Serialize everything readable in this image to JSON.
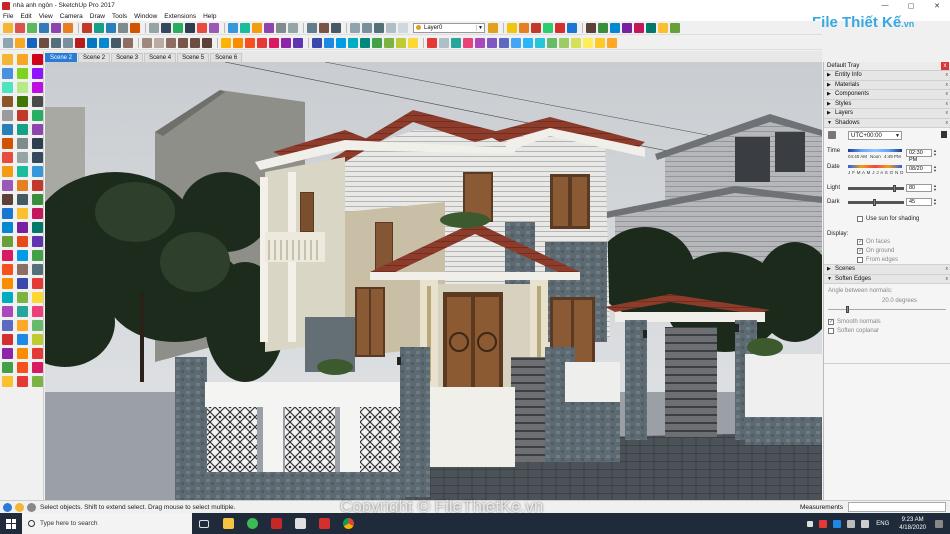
{
  "window": {
    "title": "nhà anh ngôn - SketchUp Pro 2017",
    "controls": [
      "—",
      "▢",
      "✕"
    ]
  },
  "menu": [
    "File",
    "Edit",
    "View",
    "Camera",
    "Draw",
    "Tools",
    "Window",
    "Extensions",
    "Help"
  ],
  "toolbar": {
    "layer_value": "Layer0"
  },
  "scenes": [
    "Scene 2",
    "Scene 2",
    "Scene 3",
    "Scene 4",
    "Scene 5",
    "Scene 6"
  ],
  "tray": {
    "title": "Default Tray",
    "close": "x",
    "sections_top": [
      "Entity Info",
      "Materials",
      "Components",
      "Styles",
      "Layers"
    ],
    "shadows": {
      "header": "Shadows",
      "timezone": "UTC+00:00",
      "time_label": "Time",
      "time_marks": [
        "04:40 AM",
        "Noon",
        "4:49 PM"
      ],
      "time_value": "02:30 PM",
      "date_label": "Date",
      "months": "J F M A M J J A S O N D",
      "date_value": "08/20",
      "light_label": "Light",
      "light_value": "80",
      "dark_label": "Dark",
      "dark_value": "45",
      "use_sun": "Use sun for shading",
      "display_label": "Display:",
      "on_faces": "On faces",
      "on_ground": "On ground",
      "from_edges": "From edges"
    },
    "scenes_header": "Scenes",
    "soften": {
      "header": "Soften Edges",
      "angle_label": "Angle between normals:",
      "angle_value": "20.0  degrees",
      "smooth": "Smooth normals",
      "coplanar": "Soften coplanar"
    }
  },
  "status": {
    "message": "Select objects. Shift to extend select. Drag mouse to select multiple.",
    "measurements_label": "Measurements"
  },
  "watermark": "Copyright © FileThietKe.vn",
  "logo": {
    "main": "File Thiết Kế",
    "suffix": ".vn"
  },
  "taskbar": {
    "search_placeholder": "Type here to search",
    "lang": "ENG",
    "time": "9:23 AM",
    "date": "4/18/2020"
  }
}
